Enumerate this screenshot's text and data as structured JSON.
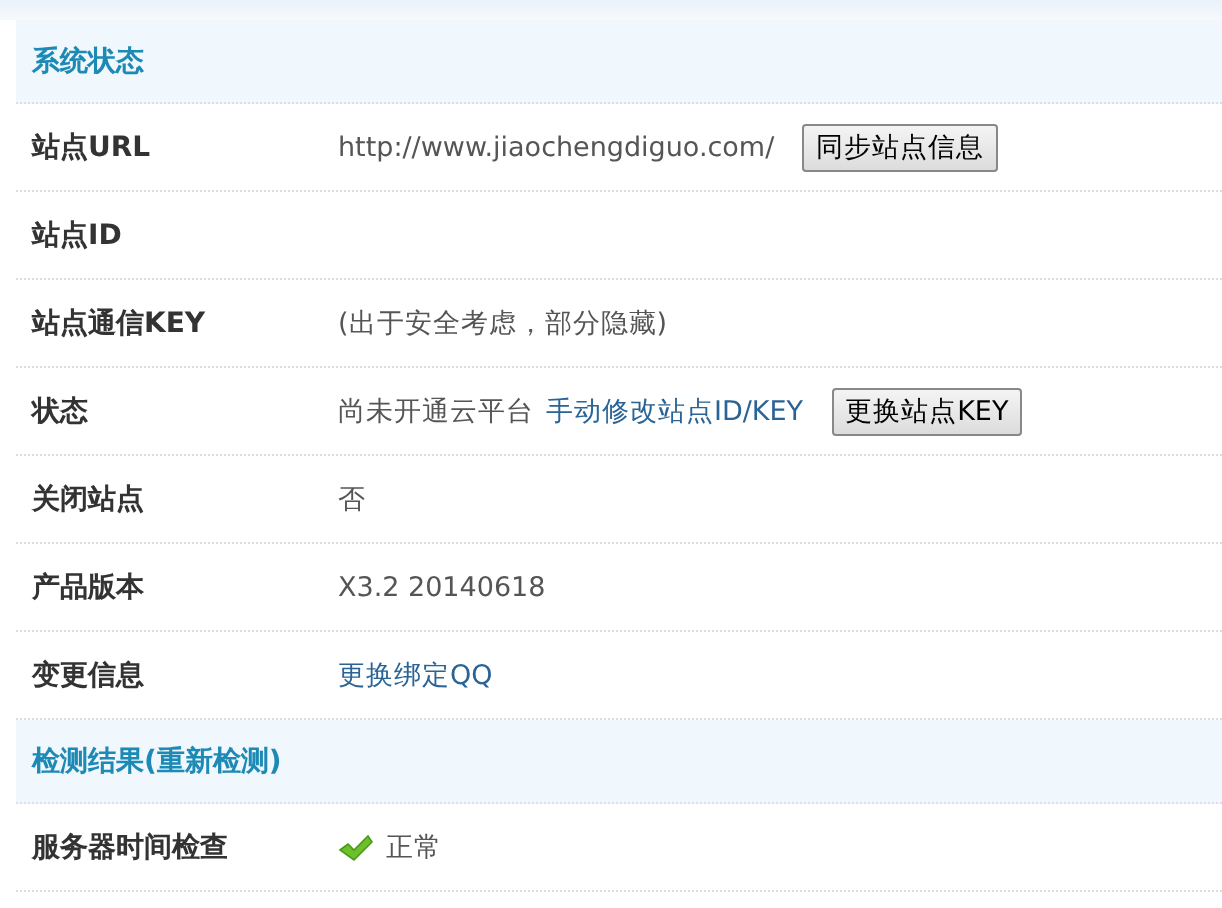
{
  "sections": [
    {
      "title": "系统状态",
      "rows": [
        {
          "label": "站点URL",
          "value": [
            {
              "kind": "text",
              "text": "http://www.jiaochengdiguo.com/"
            },
            {
              "kind": "button",
              "text": "同步站点信息"
            }
          ]
        },
        {
          "label": "站点ID",
          "value": []
        },
        {
          "label": "站点通信KEY",
          "value": [
            {
              "kind": "text",
              "text": "(出于安全考虑，部分隐藏)"
            }
          ]
        },
        {
          "label": "状态",
          "value": [
            {
              "kind": "text",
              "text": "尚未开通云平台"
            },
            {
              "kind": "link",
              "text": "手动修改站点ID/KEY"
            },
            {
              "kind": "button",
              "text": "更换站点KEY"
            }
          ]
        },
        {
          "label": "关闭站点",
          "value": [
            {
              "kind": "text",
              "text": "否"
            }
          ]
        },
        {
          "label": "产品版本",
          "value": [
            {
              "kind": "text",
              "text": "X3.2 20140618"
            }
          ]
        },
        {
          "label": "变更信息",
          "value": [
            {
              "kind": "link",
              "text": "更换绑定QQ"
            }
          ]
        }
      ]
    },
    {
      "title": "检测结果",
      "link": "(重新检测)",
      "rows": [
        {
          "label": "服务器时间检查",
          "value": [
            {
              "kind": "ok",
              "text": "正常"
            }
          ]
        }
      ]
    }
  ]
}
